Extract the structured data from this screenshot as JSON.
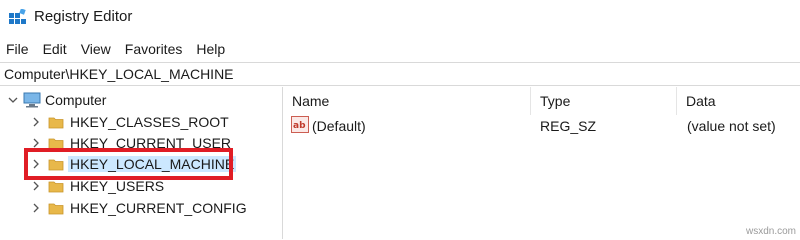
{
  "window": {
    "title": "Registry Editor"
  },
  "menu": [
    "File",
    "Edit",
    "View",
    "Favorites",
    "Help"
  ],
  "address": {
    "path": "Computer\\HKEY_LOCAL_MACHINE"
  },
  "tree": {
    "root": "Computer",
    "items": [
      {
        "label": "HKEY_CLASSES_ROOT"
      },
      {
        "label": "HKEY_CURRENT_USER"
      },
      {
        "label": "HKEY_LOCAL_MACHINE",
        "selected": true
      },
      {
        "label": "HKEY_USERS"
      },
      {
        "label": "HKEY_CURRENT_CONFIG"
      }
    ]
  },
  "list": {
    "columns": [
      "Name",
      "Type",
      "Data"
    ],
    "rows": [
      {
        "name": "(Default)",
        "type": "REG_SZ",
        "data": "(value not set)"
      }
    ]
  },
  "watermark": "wsxdn.com",
  "colors": {
    "highlight": "#e01d25",
    "selection": "#cce8ff",
    "folder": "#e8b84a"
  },
  "icons": {
    "app": "registry-editor-icon",
    "root": "computer-icon",
    "folder": "folder-icon",
    "value": "string-value-icon"
  }
}
